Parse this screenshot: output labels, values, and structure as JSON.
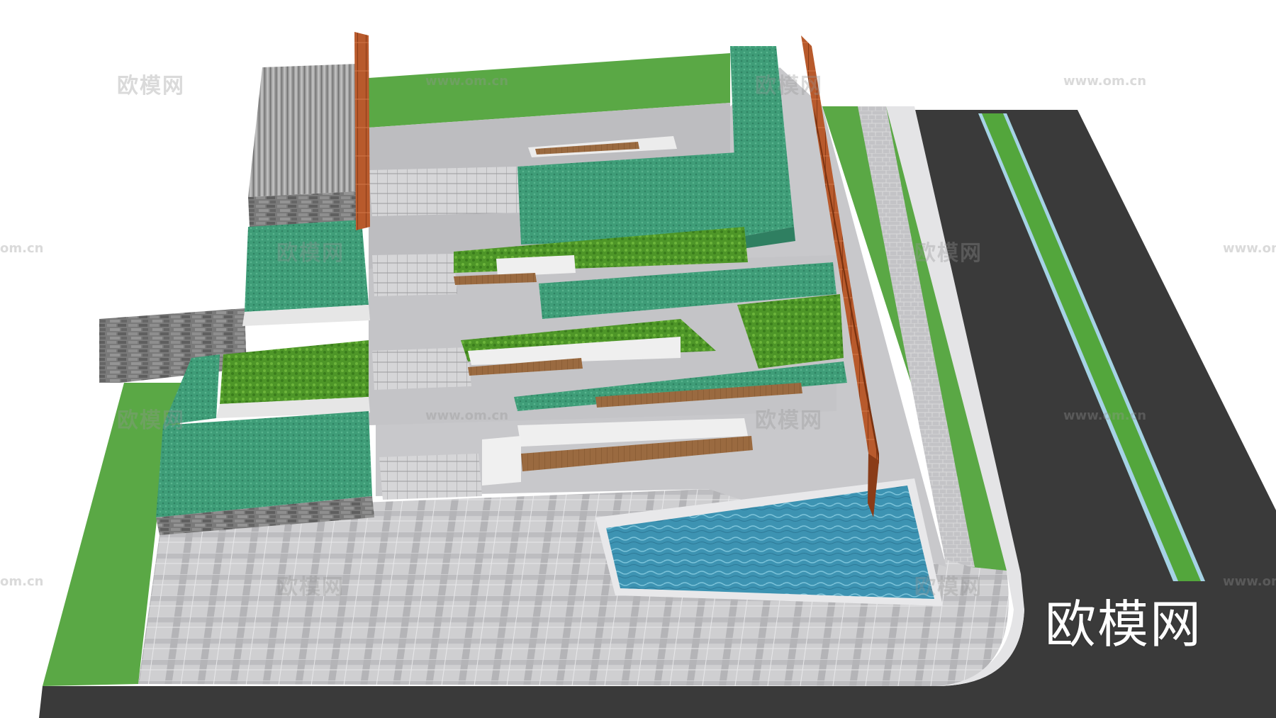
{
  "image": {
    "subject": "Aerial 3D landscape model: terraced plaza with stairs, planters, wooden benches, rusted steel screen walls, a triangular reflecting pool and an adjacent road",
    "colors": {
      "asphalt": "#3a3a3a",
      "lawn": "#5aa845",
      "terrace_ground_cover": "#3e9a74",
      "shrubs": "#4f9a2a",
      "paving": "#c9c9cb",
      "paving_grid": "#a9a9ac",
      "water": "#3f96b4",
      "corten_steel": "#b9562a",
      "timber": "#9a6a40",
      "stone_wall": "#6e6e6e"
    }
  },
  "watermarks": {
    "brand": "欧模网",
    "url": "www.om.cn",
    "url_partial": "om.cn"
  },
  "logo_text": "欧模网"
}
